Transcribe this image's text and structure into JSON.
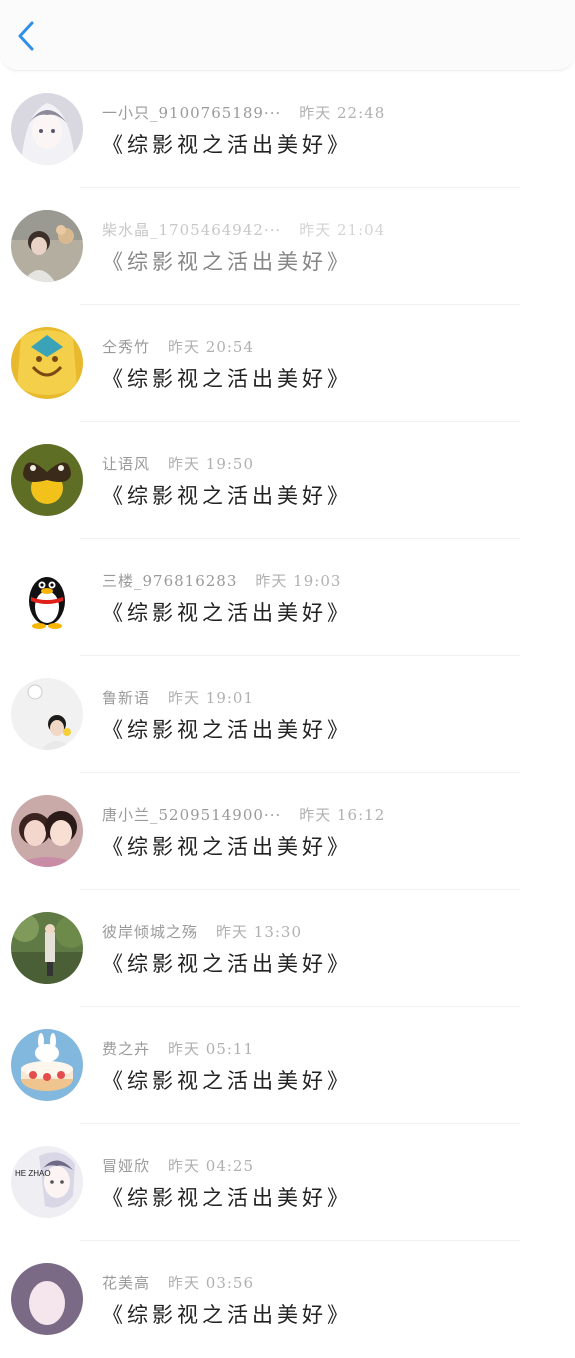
{
  "header": {
    "back_icon": "chevron-left-icon",
    "accent_color": "#2f8fea"
  },
  "messages": [
    {
      "name": "一小只_9100765189···",
      "time": "昨天 22:48",
      "text": "《综影视之活出美好》",
      "avatar": "anime-girl-silver-hair",
      "avatar_color": "#c9c6d3"
    },
    {
      "name": "柴水晶_1705464942···",
      "time": "昨天 21:04",
      "text": "《综影视之活出美好》",
      "avatar": "girl-with-flowers-photo",
      "avatar_color": "#a8a49a"
    },
    {
      "name": "仝秀竹",
      "time": "昨天 20:54",
      "text": "《综影视之活出美好》",
      "avatar": "golden-mask-art",
      "avatar_color": "#e0b52e"
    },
    {
      "name": "让语风",
      "time": "昨天 19:50",
      "text": "《综影视之活出美好》",
      "avatar": "butterfly-on-flower",
      "avatar_color": "#6a7b2a"
    },
    {
      "name": "三楼_976816283",
      "time": "昨天 19:03",
      "text": "《综影视之活出美好》",
      "avatar": "qq-penguin",
      "avatar_color": "#ffffff"
    },
    {
      "name": "鲁新语",
      "time": "昨天 19:01",
      "text": "《综影视之活出美好》",
      "avatar": "child-photo",
      "avatar_color": "#eeeeee"
    },
    {
      "name": "唐小兰_5209514900···",
      "time": "昨天 16:12",
      "text": "《综影视之活出美好》",
      "avatar": "two-women-selfie",
      "avatar_color": "#b07a7a"
    },
    {
      "name": "彼岸倾城之殇",
      "time": "昨天 13:30",
      "text": "《综影视之活出美好》",
      "avatar": "girl-in-park",
      "avatar_color": "#6f8a5a"
    },
    {
      "name": "费之卉",
      "time": "昨天 05:11",
      "text": "《综影视之活出美好》",
      "avatar": "bunny-cake",
      "avatar_color": "#7fb3d9"
    },
    {
      "name": "冒娅欣",
      "time": "昨天 04:25",
      "text": "《综影视之活出美好》",
      "avatar": "anime-boy-he-zhao",
      "avatar_color": "#e8e8ef",
      "avatar_text": "HE ZHAO"
    },
    {
      "name": "花美高",
      "time": "昨天 03:56",
      "text": "《综影视之活出美好》",
      "avatar": "partial-avatar",
      "avatar_color": "#6d5f7a"
    }
  ]
}
